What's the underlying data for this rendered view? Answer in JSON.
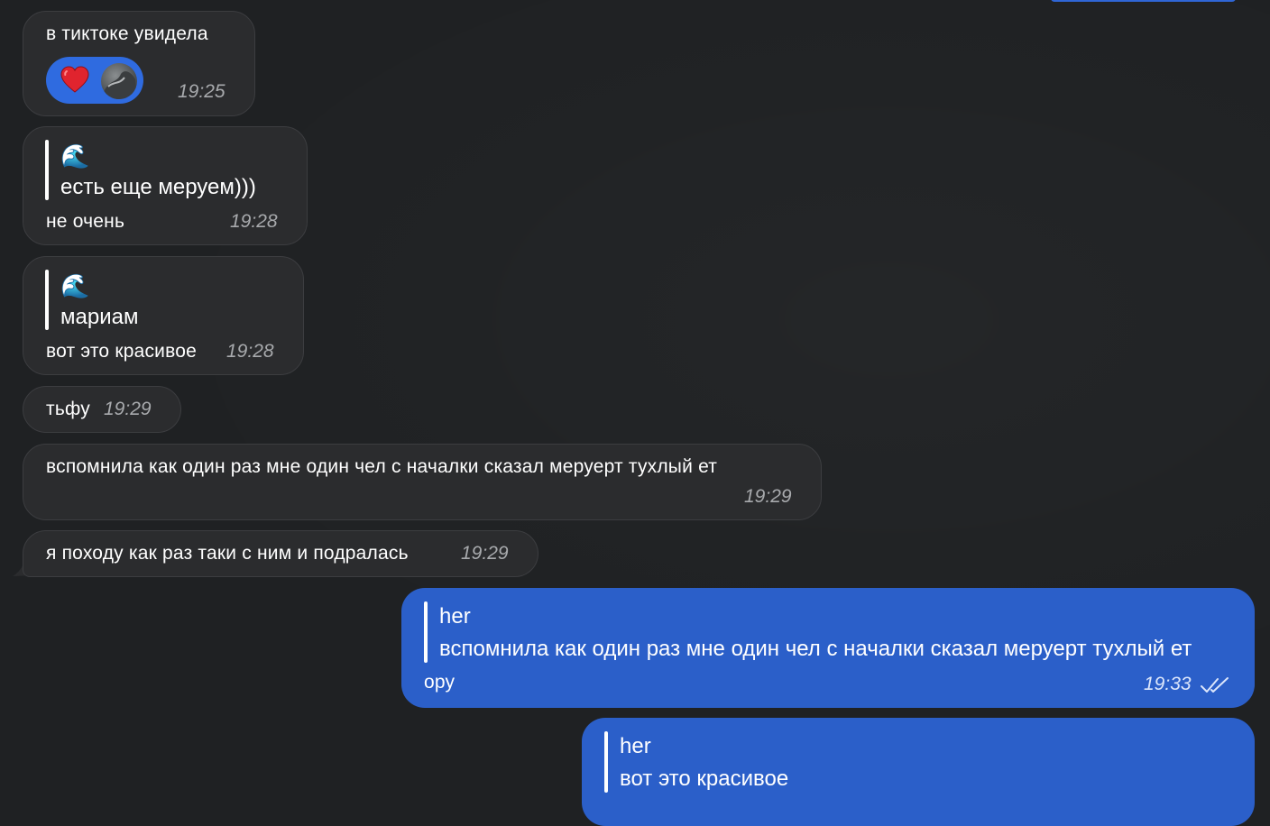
{
  "messages": [
    {
      "text": "в тиктоке увидела",
      "time": "19:25",
      "reaction": {
        "emoji": "heart"
      }
    },
    {
      "quote_title": "🌊",
      "quote_text": "есть еще меруем)))",
      "text": "не очень",
      "time": "19:28"
    },
    {
      "quote_title": "🌊",
      "quote_text": "мариам",
      "text": "вот это красивое",
      "time": "19:28"
    },
    {
      "text": "тьфу",
      "time": "19:29"
    },
    {
      "text": "вспомнила как один раз мне один чел с началки сказал меруерт тухлый ет",
      "time": "19:29"
    },
    {
      "text": "я походу как раз таки с ним и подралась",
      "time": "19:29"
    }
  ],
  "outgoing": [
    {
      "quote_title": "her",
      "quote_text": "вспомнила как один раз мне один чел с началки сказал меруерт тухлый ет",
      "text": "ору",
      "time": "19:33"
    },
    {
      "quote_title": "her",
      "quote_text": "вот это красивое"
    }
  ],
  "colors": {
    "background": "#1f2123",
    "incoming_bubble": "#2b2c2e",
    "outgoing_bubble": "#2b5fc9",
    "reaction": "#2f6be0"
  }
}
